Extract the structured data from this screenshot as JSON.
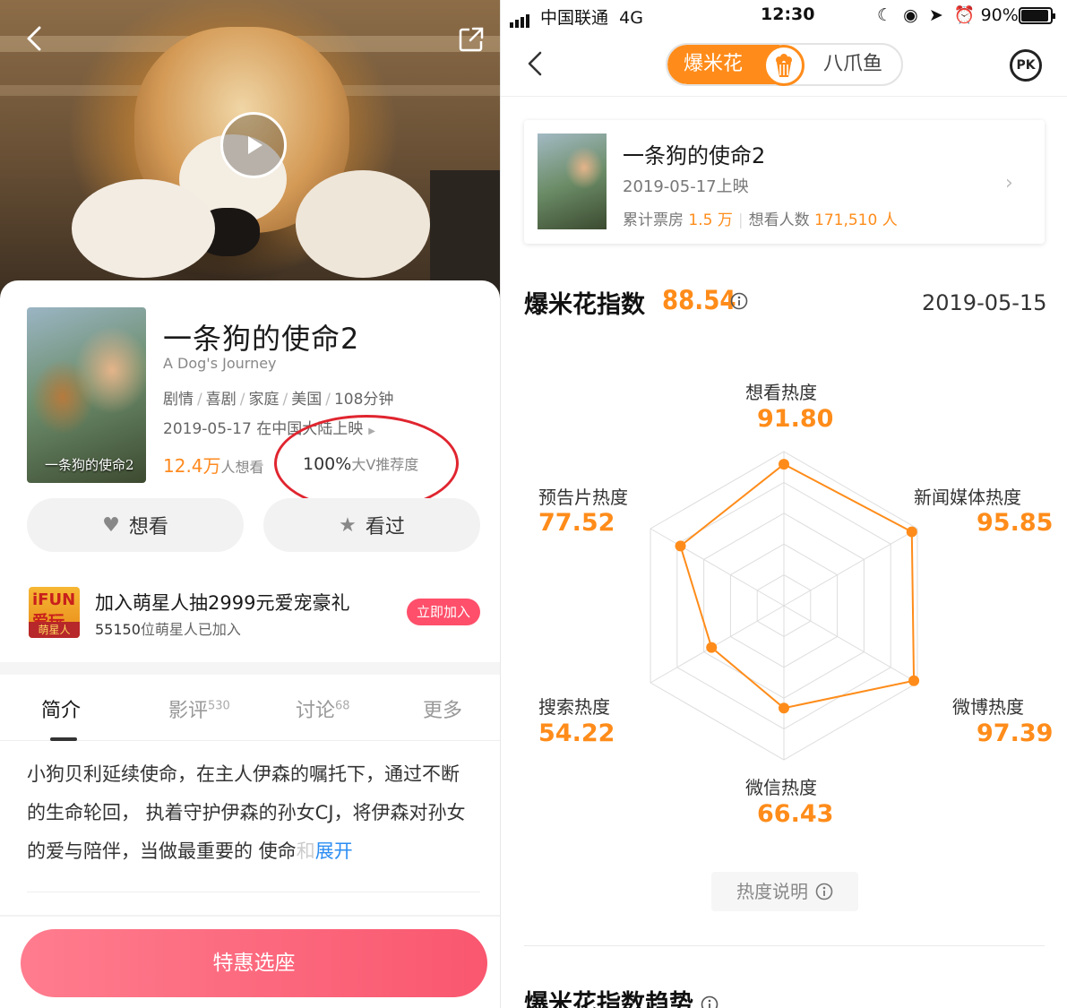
{
  "left": {
    "movie": {
      "title": "一条狗的使命2",
      "en_title": "A Dog's Journey",
      "genres": [
        "剧情",
        "喜剧",
        "家庭",
        "美国",
        "108分钟"
      ],
      "release": "2019-05-17 在中国大陆上映",
      "want_count": "12.4万",
      "want_suffix": "人想看",
      "recommend_pct": "100%",
      "recommend_label": "大V推荐度",
      "poster_text": "一条狗的使命2"
    },
    "buttons": {
      "want": "想看",
      "seen": "看过"
    },
    "promo": {
      "logo_top": "iFUN 爱玩",
      "logo_bottom": "萌星人",
      "title": "加入萌星人抽2999元爱宠豪礼",
      "count": "55150",
      "count_suffix": "位萌星人已加入",
      "join": "立即加入"
    },
    "tabs": [
      {
        "label": "简介",
        "count": ""
      },
      {
        "label": "影评",
        "count": "530"
      },
      {
        "label": "讨论",
        "count": "68"
      },
      {
        "label": "更多",
        "count": ""
      }
    ],
    "description": "小狗贝利延续使命，在主人伊森的嘱托下，通过不断的生命轮回， 执着守护伊森的孙女CJ，将伊森对孙女的爱与陪伴，当做最重要的 使命",
    "description_fade": "和",
    "expand": "展开",
    "buy": "特惠选座"
  },
  "right": {
    "status": {
      "carrier": "中国联通",
      "network": "4G",
      "time": "12:30",
      "battery": "90%"
    },
    "segment": {
      "active": "爆米花",
      "inactive": "八爪鱼"
    },
    "pk": "PK",
    "card": {
      "title": "一条狗的使命2",
      "date": "2019-05-17上映",
      "box_label": "累计票房",
      "box_value": "1.5 万",
      "want_label": "想看人数",
      "want_value": "171,510 人"
    },
    "index": {
      "label": "爆米花指数",
      "value": "88.54",
      "date": "2019-05-15"
    },
    "radar": [
      {
        "name": "想看热度",
        "value": 91.8,
        "display": "91.80"
      },
      {
        "name": "新闻媒体热度",
        "value": 95.85,
        "display": "95.85"
      },
      {
        "name": "微博热度",
        "value": 97.39,
        "display": "97.39"
      },
      {
        "name": "微信热度",
        "value": 66.43,
        "display": "66.43"
      },
      {
        "name": "搜索热度",
        "value": 54.22,
        "display": "54.22"
      },
      {
        "name": "预告片热度",
        "value": 77.52,
        "display": "77.52"
      }
    ],
    "hot_explain": "热度说明",
    "trend_title": "爆米花指数趋势"
  },
  "colors": {
    "accent": "#ff8c1a",
    "pink": "#f9576f",
    "highlight": "#e0252f",
    "link": "#2b8df2"
  }
}
